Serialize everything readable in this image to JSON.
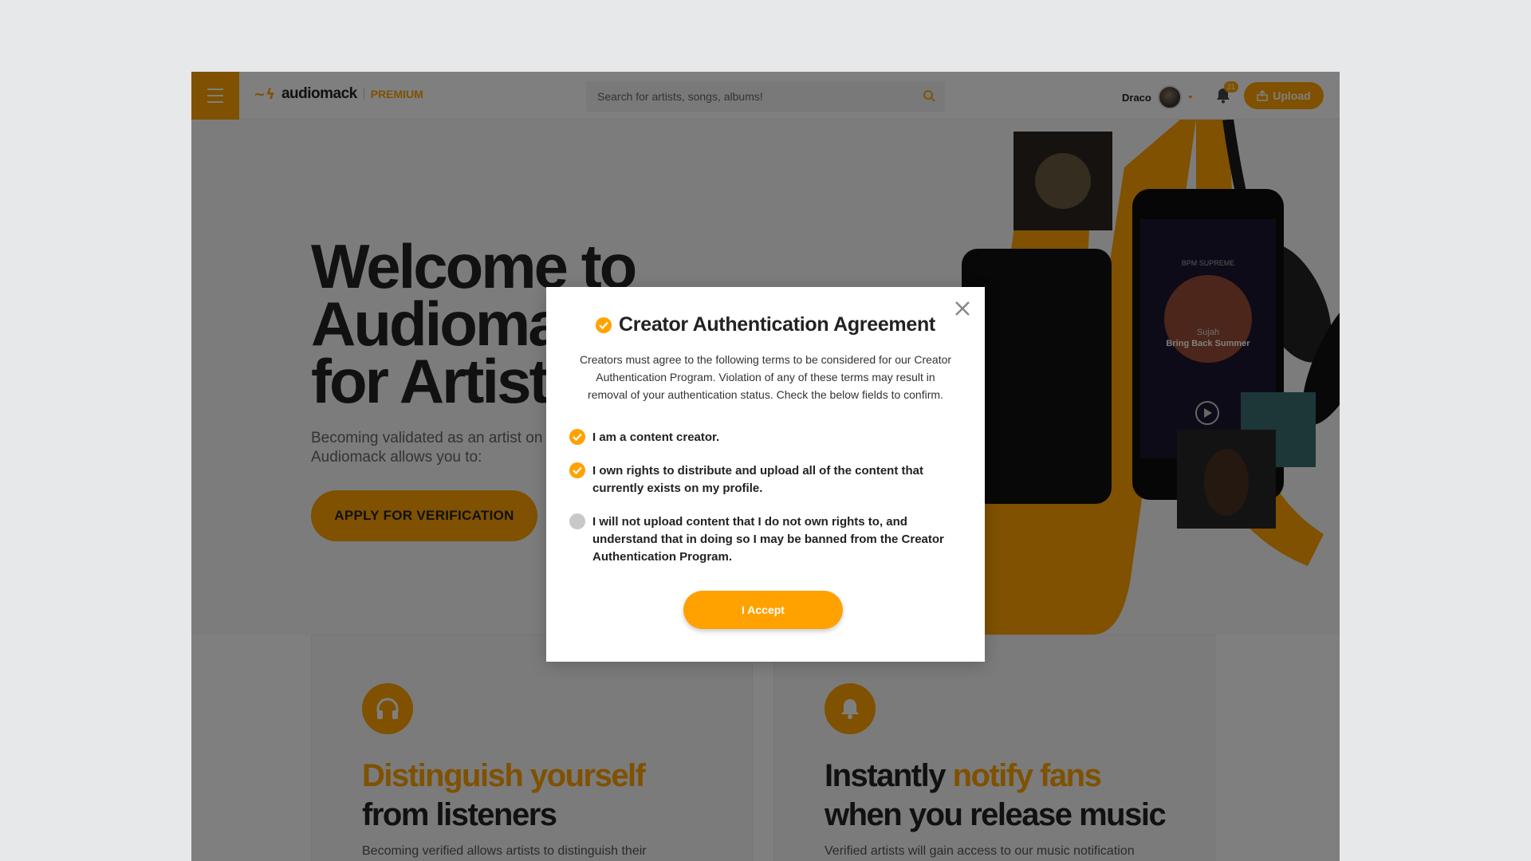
{
  "header": {
    "logo_text": "audiomack",
    "logo_badge": "PREMIUM",
    "search_placeholder": "Search for artists, songs, albums!",
    "user_name": "Draco",
    "notification_count": "21",
    "upload_label": "Upload"
  },
  "hero": {
    "title_line1": "Welcome to",
    "title_line2": "Audiomack",
    "title_line3": "for Artists",
    "subtitle": "Becoming validated as an artist on Audiomack allows you to:",
    "apply_label": "APPLY FOR VERIFICATION",
    "phone_artist": "Sujah",
    "phone_track": "Bring Back Summer",
    "phone_label": "BPM SUPREME"
  },
  "features": [
    {
      "title_highlight": "Distinguish yourself",
      "title_rest": "from listeners",
      "text": "Becoming verified allows artists to distinguish their",
      "icon": "headphones-icon"
    },
    {
      "title_prefix": "Instantly",
      "title_highlight": "notify fans",
      "title_rest": "when you release music",
      "text": "Verified artists will gain access to our music notification",
      "icon": "bell-icon"
    }
  ],
  "modal": {
    "title": "Creator Authentication Agreement",
    "description": "Creators must agree to the following terms to be considered for our Creator Authentication Program. Violation of any of these terms may result in removal of your authentication status. Check the below fields to confirm.",
    "terms": [
      {
        "label": "I am a content creator.",
        "checked": true
      },
      {
        "label": "I own rights to distribute and upload all of the content that currently exists on my profile.",
        "checked": true
      },
      {
        "label": "I will not upload content that I do not own rights to, and understand that in doing so I may be banned from the Creator Authentication Program.",
        "checked": false
      }
    ],
    "accept_label": "I Accept"
  },
  "colors": {
    "accent": "#ffa200",
    "overlay": "rgba(0,0,0,0.5)",
    "unchecked": "#c8c8c8"
  }
}
